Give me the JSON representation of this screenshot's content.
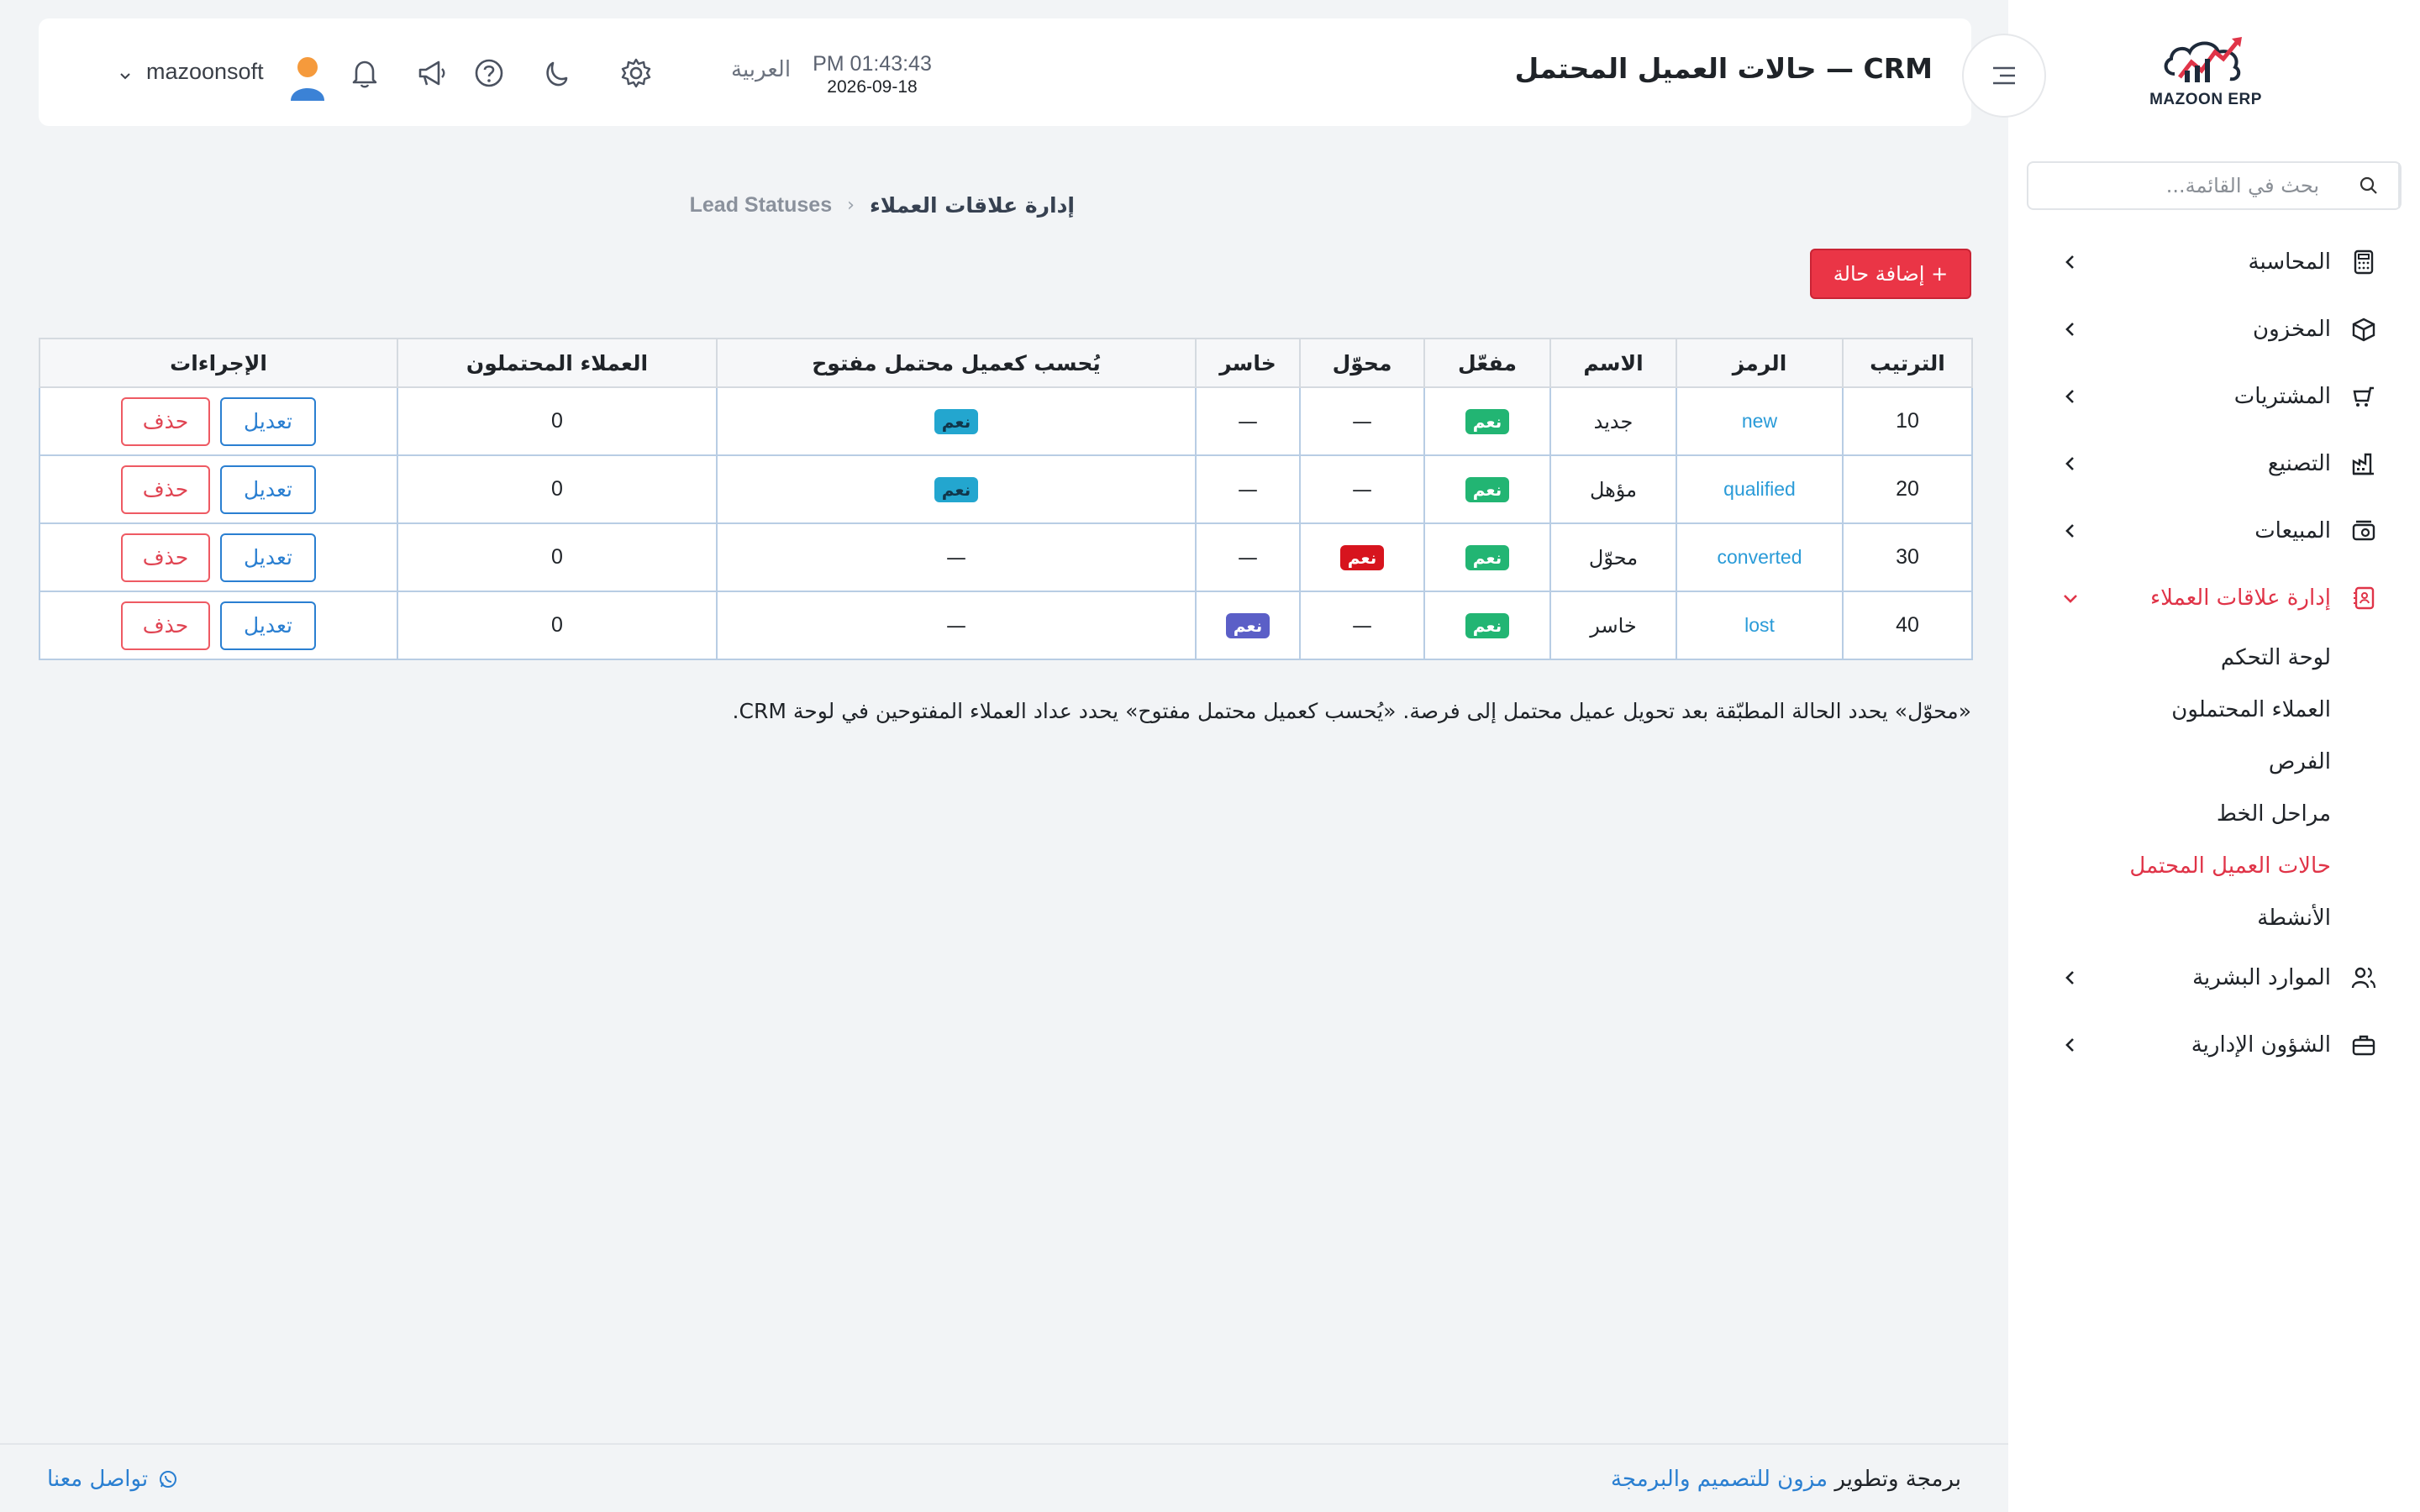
{
  "brand": {
    "logo_text": "MAZOON ERP",
    "accent": "#e03448"
  },
  "sidebar": {
    "search_placeholder": "بحث في القائمة...",
    "items": [
      {
        "label": "المحاسبة",
        "icon": "calculator-icon"
      },
      {
        "label": "المخزون",
        "icon": "box-icon"
      },
      {
        "label": "المشتريات",
        "icon": "cart-icon"
      },
      {
        "label": "التصنيع",
        "icon": "factory-icon"
      },
      {
        "label": "المبيعات",
        "icon": "register-icon"
      },
      {
        "label": "إدارة علاقات العملاء",
        "icon": "contacts-icon",
        "active": true
      },
      {
        "label": "الموارد البشرية",
        "icon": "users-icon"
      },
      {
        "label": "الشؤون الإدارية",
        "icon": "briefcase-icon"
      }
    ],
    "crm_sub": [
      {
        "label": "لوحة التحكم"
      },
      {
        "label": "العملاء المحتملون"
      },
      {
        "label": "الفرص"
      },
      {
        "label": "مراحل الخط"
      },
      {
        "label": "حالات العميل المحتمل",
        "active": true
      },
      {
        "label": "الأنشطة"
      }
    ]
  },
  "header": {
    "title": "CRM — حالات العميل المحتمل",
    "time": "PM 01:43:43",
    "date": "2026-09-18",
    "language": "العربية",
    "user": "mazoonsoft"
  },
  "breadcrumb": {
    "main": "إدارة علاقات العملاء",
    "current": "Lead Statuses"
  },
  "add_button": "+ إضافة حالة",
  "table": {
    "headers": [
      "الترتيب",
      "الرمز",
      "الاسم",
      "مفعّل",
      "محوّل",
      "خاسر",
      "يُحسب كعميل محتمل مفتوح",
      "العملاء المحتملون",
      "الإجراءات"
    ],
    "yes": "نعم",
    "dash": "—",
    "edit": "تعديل",
    "delete": "حذف",
    "rows": [
      {
        "order": "10",
        "code": "new",
        "name": "جديد",
        "active": true,
        "converted": false,
        "lost": false,
        "open": true,
        "leads": "0"
      },
      {
        "order": "20",
        "code": "qualified",
        "name": "مؤهل",
        "active": true,
        "converted": false,
        "lost": false,
        "open": true,
        "leads": "0"
      },
      {
        "order": "30",
        "code": "converted",
        "name": "محوّل",
        "active": true,
        "converted": true,
        "lost": false,
        "open": false,
        "leads": "0"
      },
      {
        "order": "40",
        "code": "lost",
        "name": "خاسر",
        "active": true,
        "converted": false,
        "lost": true,
        "open": false,
        "leads": "0"
      }
    ]
  },
  "note": "«محوّل» يحدد الحالة المطبّقة بعد تحويل عميل محتمل إلى فرصة. «يُحسب كعميل محتمل مفتوح» يحدد عداد العملاء المفتوحين في لوحة CRM.",
  "footer": {
    "credit_prefix": "برمجة وتطوير",
    "credit_link": "مزون للتصميم والبرمجة",
    "contact": "تواصل معنا"
  }
}
